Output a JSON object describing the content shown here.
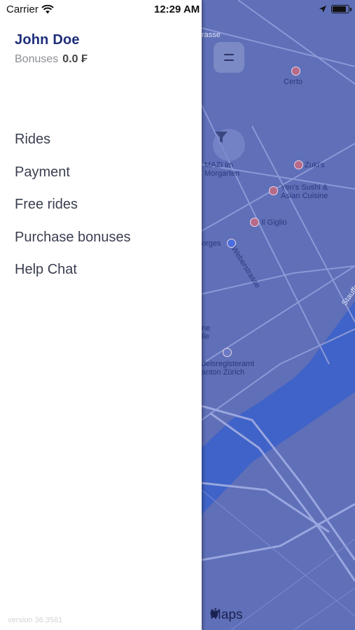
{
  "status_bar": {
    "carrier": "Carrier",
    "time": "12:29 AM"
  },
  "user": {
    "name": "John  Doe",
    "bonuses_label": "Bonuses",
    "bonuses_value": "0.0 ₣"
  },
  "menu": {
    "items": [
      {
        "label": "Rides"
      },
      {
        "label": "Payment"
      },
      {
        "label": "Free rides"
      },
      {
        "label": "Purchase bonuses"
      },
      {
        "label": "Help Chat"
      }
    ]
  },
  "map": {
    "labels": {
      "strasse_top": "rasse",
      "certo": "Certo",
      "mazi": "MAZI im\nMorgarten",
      "zukis": "Zuki's",
      "yens": "Yen's Sushi &\nAsian Cuisine",
      "il_giglio": "Il Giglio",
      "borges": "orges",
      "weberstrasse": "Weberstrasse",
      "stauff": "Stauffacherstrasse",
      "ne_lle": "ne\nlle",
      "handelsregister": "delsregisteramt\nanton Zürich"
    },
    "brand": "Maps"
  },
  "footer": {
    "version": "version 36.3581"
  },
  "colors": {
    "accent": "#1d2e7a",
    "map_overlay": "#5f6fb8",
    "water": "#3f63c8"
  }
}
